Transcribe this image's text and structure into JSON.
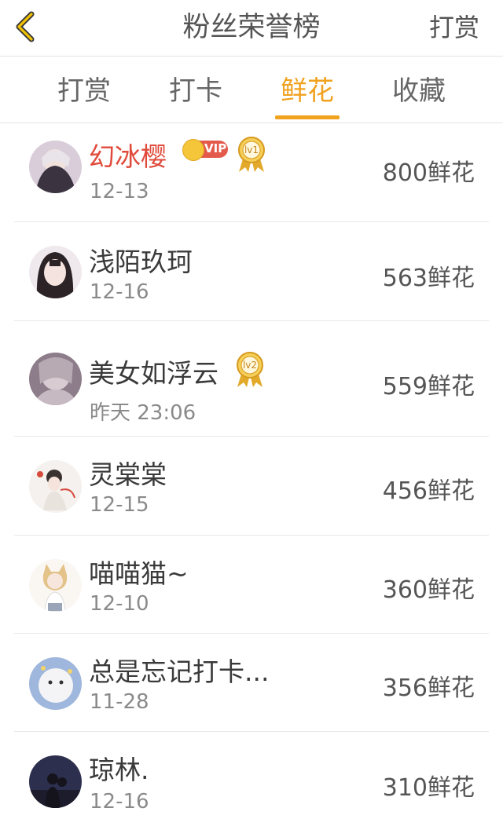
{
  "header": {
    "title": "粉丝荣誉榜",
    "action": "打赏"
  },
  "tabs": [
    {
      "label": "打赏",
      "active": false
    },
    {
      "label": "打卡",
      "active": false
    },
    {
      "label": "鲜花",
      "active": true
    },
    {
      "label": "收藏",
      "active": false
    }
  ],
  "colors": {
    "accent": "#f0a21f",
    "vip_name": "#e04a3b",
    "vip_badge": "#e35a4c"
  },
  "list": [
    {
      "name": "幻冰樱",
      "date": "12-13",
      "count": "800鲜花",
      "vip": true,
      "vip_label": "VIP",
      "medal": "lv1"
    },
    {
      "name": "浅陌玖珂",
      "date": "12-16",
      "count": "563鲜花",
      "vip": false
    },
    {
      "name": "美女如浮云",
      "date": "昨天 23:06",
      "count": "559鲜花",
      "vip": false,
      "medal": "lv2"
    },
    {
      "name": "灵棠棠",
      "date": "12-15",
      "count": "456鲜花",
      "vip": false
    },
    {
      "name": "喵喵猫~",
      "date": "12-10",
      "count": "360鲜花",
      "vip": false
    },
    {
      "name": "总是忘记打卡...",
      "date": "11-28",
      "count": "356鲜花",
      "vip": false
    },
    {
      "name": "琼林.",
      "date": "12-16",
      "count": "310鲜花",
      "vip": false
    }
  ]
}
